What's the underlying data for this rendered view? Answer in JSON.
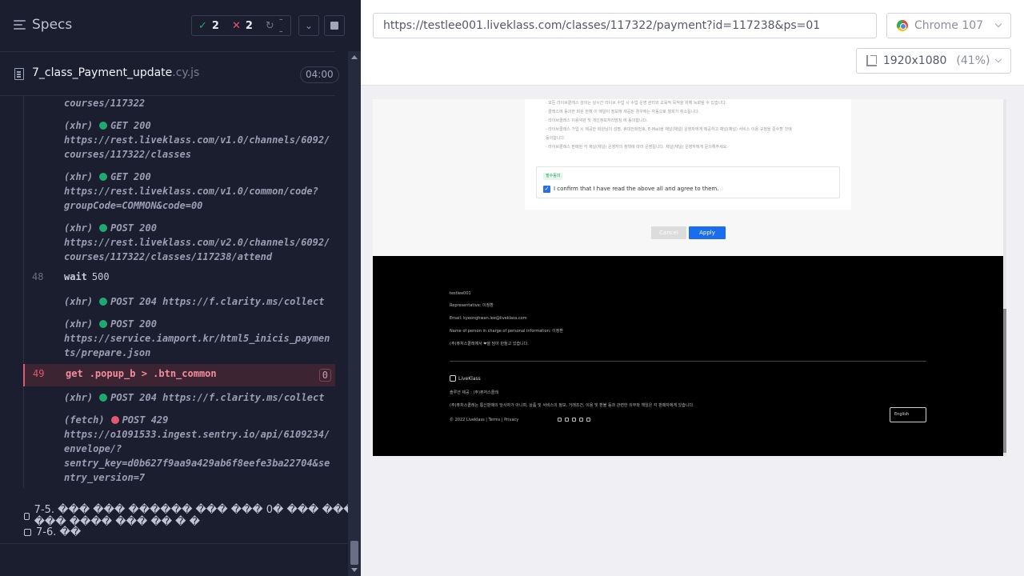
{
  "runner": {
    "header": {
      "title": "Specs",
      "passed": "2",
      "failed": "2",
      "pending": "--"
    },
    "spec_file": {
      "name": "7_class_Payment_update",
      "ext": ".cy.js",
      "duration": "04:00"
    },
    "log": {
      "pre_url_tail": "courses/117322",
      "entries": [
        {
          "kind": "(xhr)",
          "method": "GET 200",
          "url1": "https://rest.liveklass.com/v1.0/channels/6092/",
          "url2": "courses/117322/classes",
          "url3": ""
        },
        {
          "kind": "(xhr)",
          "method": "GET 200",
          "url1": "https://rest.liveklass.com/v1.0/common/code?",
          "url2": "groupCode=COMMON&code=00",
          "url3": ""
        },
        {
          "kind": "(xhr)",
          "method": "POST 200",
          "url1": "https://rest.liveklass.com/v2.0/channels/6092/",
          "url2": "courses/117322/classes/117238/attend",
          "url3": ""
        }
      ],
      "wait": {
        "num": "48",
        "cmd": "wait",
        "arg": "500"
      },
      "clarity1": {
        "kind": "(xhr)",
        "method": "POST 204",
        "url": "https://f.clarity.ms/collect"
      },
      "iamport": {
        "kind": "(xhr)",
        "method": "POST 200",
        "url1": "https://service.iamport.kr/html5_inicis_paymen",
        "url2": "ts/prepare.json"
      },
      "failed_cmd": {
        "num": "49",
        "cmd": "get",
        "selector": ".popup_b > .btn_common",
        "count": "0"
      },
      "clarity2": {
        "kind": "(xhr)",
        "method": "POST 204",
        "url": "https://f.clarity.ms/collect"
      },
      "sentry": {
        "kind": "(fetch)",
        "method": "POST 429",
        "url1": "https://o1091533.ingest.sentry.io/api/6109234/",
        "url2": "envelope/?",
        "url3": "sentry_key=d0b627f9aa9a429ab6f8eefe3ba22704&se",
        "url4": "ntry_version=7"
      }
    },
    "tests": [
      {
        "label": "7-5. ��� ��� ������ ��� ��� 0� ��� ��� ��� ���� ��� �� � �"
      },
      {
        "label": "7-6. ��"
      }
    ]
  },
  "browser": {
    "url": "https://testlee001.liveklass.com/classes/117322/payment?id=117238&ps=01",
    "browser_name": "Chrome 107",
    "viewport": "1920x1080",
    "zoom": "(41%)"
  },
  "app": {
    "terms_lines": [
      "· 모든 라이브클래스 강의는 실시간 라이브 수업 시 수업 운영 관리와 교육적 목적을 위해 녹화될 수 있습니다.",
      "· 클래스에 동의한 회원 한해 이 메일이 정보에 재공된 경우에는 자동으로 철회가 취소됩니다.",
      "· 라이브클래스 이용약관 및 개인정보처리방침 에 동의합니다.",
      "· 라이브클래스 가입 시 제공한 회원님의 성명, 휴대전화번호, E-Mail을 채널(채널) 운영자에게 제공하고 채널(채널) 서비스 이용 규정을 준수할 것에",
      "  동의합니다.",
      "· 라이브클래스 판매된 각 채널(채널) 운영자의 정책에 따라 운영됩니다. 채널(채널) 운영자에게 문의해주세요."
    ],
    "required_tag": "필수동의",
    "agree_text": "I confirm that I have read the above all and agree to them.",
    "cancel_label": "Cancel",
    "apply_label": "Apply",
    "footer": {
      "company": "testlee001",
      "representative": "Representative: 이정환",
      "email": "Email: kyeonghwan.lee@liveklass.com",
      "privacy_officer": "Name of person in charge of personal information: 이정환",
      "made_with": "(주)퓨처스콜레에서 ❤을 담아 만들고 있습니다.",
      "logo": "LiveKlass",
      "provider": "솔루션 제공 : (주)퓨처스콜레",
      "disclaimer": "(주)퓨처스콜레는 통신판매의 당사자가 아니며, 상품 및 서비스의 정보, 거래조건, 이용 및 환불 등과 관련한 의무와 책임은 각 판매자에게 있습니다.",
      "copyright": "© 2022 Liveklass  |  Terms  |  Privacy",
      "language": "English"
    }
  },
  "colors": {
    "runner_bg": "#1b1e2e",
    "pass": "#1fa971",
    "fail": "#e45770",
    "apply": "#1a6cf0"
  }
}
